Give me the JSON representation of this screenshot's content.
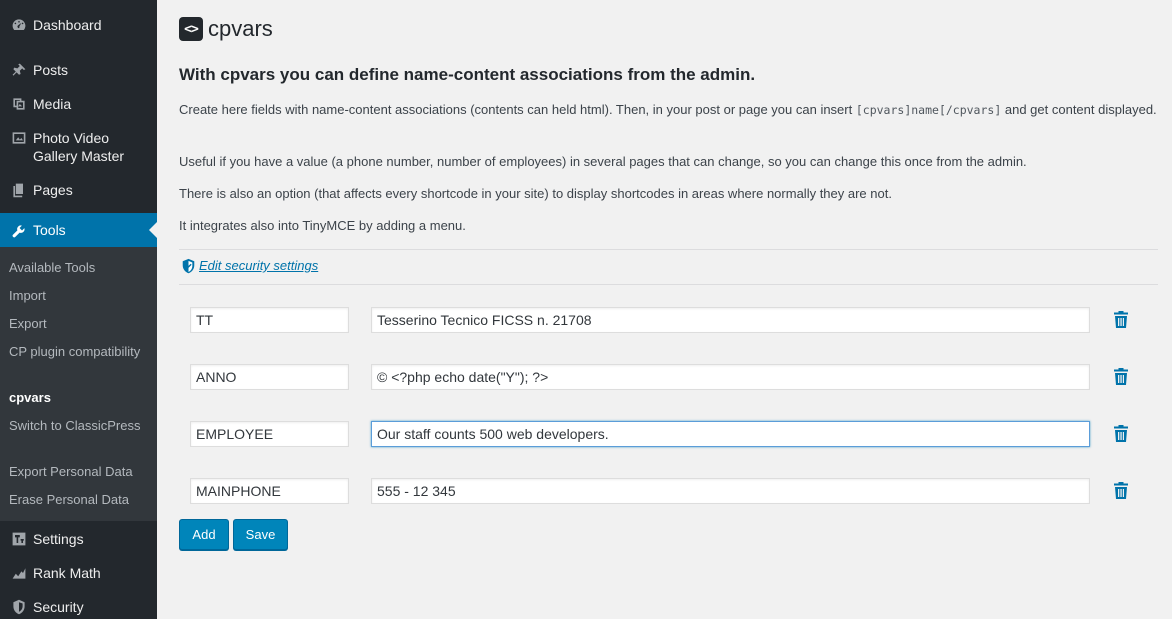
{
  "sidebar": {
    "menu": [
      {
        "label": "Dashboard",
        "icon": "dashboard-icon"
      },
      {
        "label": "Posts",
        "icon": "pin-icon"
      },
      {
        "label": "Media",
        "icon": "media-icon"
      },
      {
        "label": "Photo Video Gallery Master",
        "icon": "gallery-icon"
      },
      {
        "label": "Pages",
        "icon": "pages-icon"
      },
      {
        "label": "Tools",
        "icon": "wrench-icon"
      },
      {
        "label": "Settings",
        "icon": "settings-icon"
      },
      {
        "label": "Rank Math",
        "icon": "chart-icon"
      },
      {
        "label": "Security",
        "icon": "shield-icon"
      }
    ],
    "submenu": [
      "Available Tools",
      "Import",
      "Export",
      "CP plugin compatibility",
      "cpvars",
      "Switch to ClassicPress",
      "Export Personal Data",
      "Erase Personal Data"
    ],
    "current_submenu": "cpvars"
  },
  "page": {
    "logo_glyph": "<>",
    "title": "cpvars",
    "heading": "With cpvars you can define name-content associations from the admin.",
    "intro_before_code": "Create here fields with name-content associations (contents can held html). Then, in your post or page you can insert ",
    "intro_code": "[cpvars]name[/cpvars]",
    "intro_after_code": " and get content displayed.",
    "para2": "Useful if you have a value (a phone number, number of employees) in several pages that can change, so you can change this once from the admin.",
    "para3": "There is also an option (that affects every shortcode in your site) to display shortcodes in areas where normally they are not.",
    "para4": "It integrates also into TinyMCE by adding a menu.",
    "security_link": "Edit security settings"
  },
  "vars": [
    {
      "name": "TT",
      "content": "Tesserino Tecnico FICSS n. 21708"
    },
    {
      "name": "ANNO",
      "content": "© <?php echo date(\"Y\"); ?>"
    },
    {
      "name": "EMPLOYEE",
      "content": "Our staff counts 500 web developers."
    },
    {
      "name": "MAINPHONE",
      "content": "555 - 12 345"
    }
  ],
  "buttons": {
    "add": "Add",
    "save": "Save"
  },
  "colors": {
    "sidebar_bg": "#23282d",
    "submenu_bg": "#32373c",
    "accent": "#0073aa",
    "button": "#0085ba"
  }
}
